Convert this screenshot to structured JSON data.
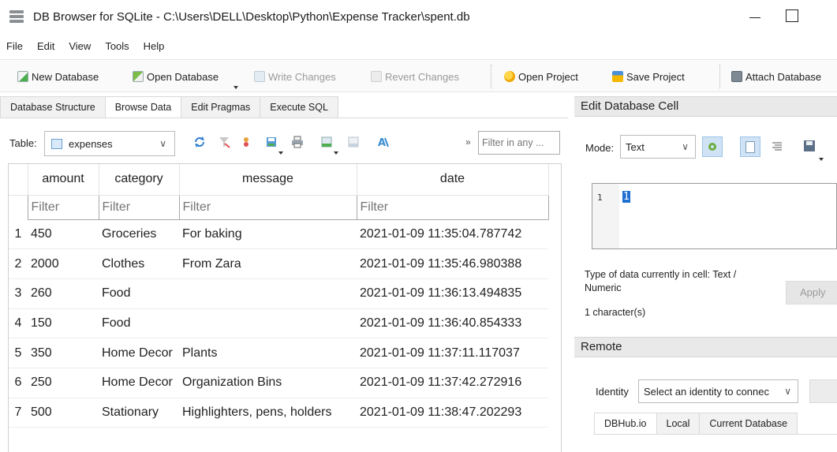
{
  "window": {
    "title": "DB Browser for SQLite - C:\\Users\\DELL\\Desktop\\Python\\Expense Tracker\\spent.db"
  },
  "menu": [
    "File",
    "Edit",
    "View",
    "Tools",
    "Help"
  ],
  "toolbar": {
    "new_database": "New Database",
    "open_database": "Open Database",
    "write_changes": "Write Changes",
    "revert_changes": "Revert Changes",
    "open_project": "Open Project",
    "save_project": "Save Project",
    "attach_database": "Attach Database"
  },
  "tabs": [
    "Database Structure",
    "Browse Data",
    "Edit Pragmas",
    "Execute SQL"
  ],
  "active_tab": "Browse Data",
  "browse": {
    "table_label": "Table:",
    "table_name": "expenses",
    "filter_all_placeholder": "Filter in any ...",
    "more_glyph": "»"
  },
  "grid": {
    "columns": [
      "amount",
      "category",
      "message",
      "date"
    ],
    "filter_placeholder": "Filter",
    "rows": [
      {
        "n": "1",
        "cells": [
          "450",
          "Groceries",
          "For baking",
          "2021-01-09 11:35:04.787742"
        ]
      },
      {
        "n": "2",
        "cells": [
          "2000",
          "Clothes",
          "From Zara",
          "2021-01-09 11:35:46.980388"
        ]
      },
      {
        "n": "3",
        "cells": [
          "260",
          "Food",
          "",
          "2021-01-09 11:36:13.494835"
        ]
      },
      {
        "n": "4",
        "cells": [
          "150",
          "Food",
          "",
          "2021-01-09 11:36:40.854333"
        ]
      },
      {
        "n": "5",
        "cells": [
          "350",
          "Home Decor",
          "Plants",
          "2021-01-09 11:37:11.117037"
        ]
      },
      {
        "n": "6",
        "cells": [
          "250",
          "Home Decor",
          "Organization Bins",
          "2021-01-09 11:37:42.272916"
        ]
      },
      {
        "n": "7",
        "cells": [
          "500",
          "Stationary",
          "Highlighters, pens, holders",
          "2021-01-09 11:38:47.202293"
        ]
      }
    ]
  },
  "edit_cell": {
    "header": "Edit Database Cell",
    "mode_label": "Mode:",
    "mode_value": "Text",
    "line_number": "1",
    "value": "1",
    "type_info_line1": "Type of data currently in cell: Text /",
    "type_info_line2": "Numeric",
    "char_count": "1 character(s)",
    "apply_label": "Apply"
  },
  "remote": {
    "header": "Remote",
    "identity_label": "Identity",
    "identity_placeholder": "Select an identity to connec",
    "tabs": [
      "DBHub.io",
      "Local",
      "Current Database"
    ]
  },
  "colors": {
    "selection_blue": "#1f6fd1",
    "panel_header": "#e9e9e9"
  }
}
